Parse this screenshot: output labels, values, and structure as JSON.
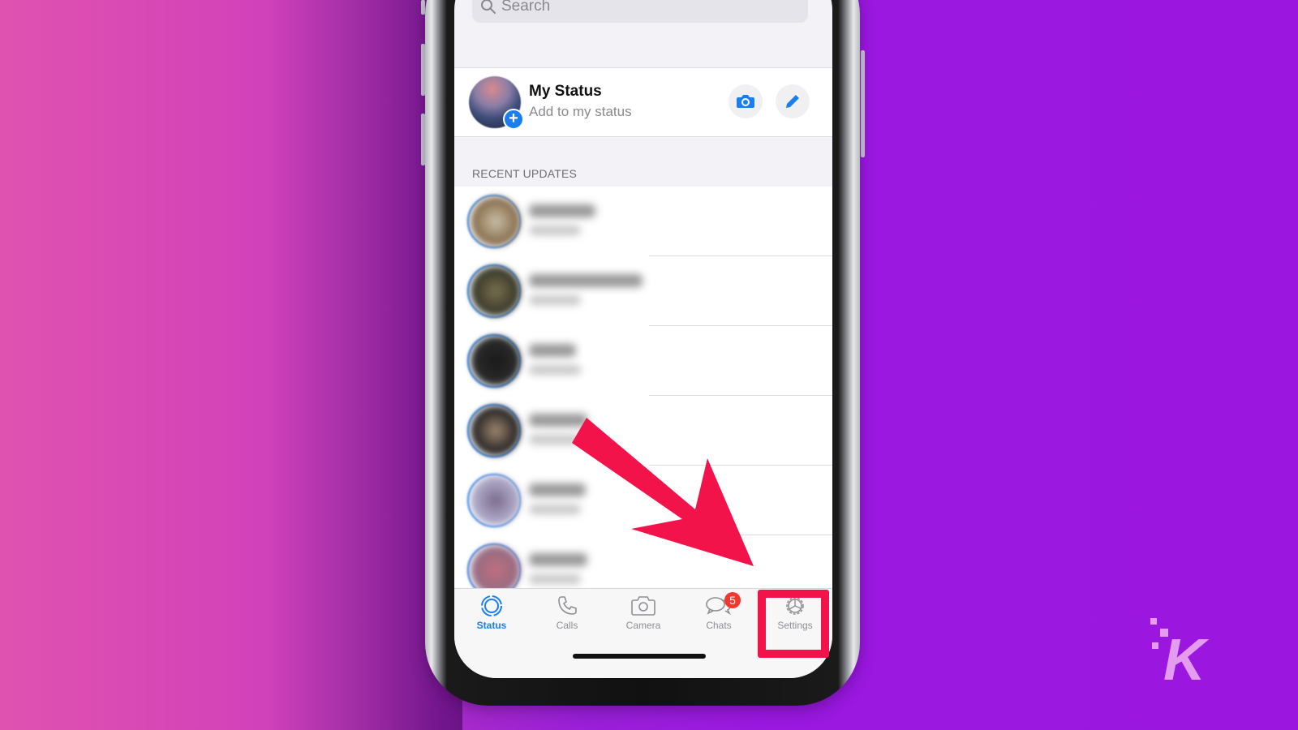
{
  "search": {
    "placeholder": "Search"
  },
  "my_status": {
    "title": "My Status",
    "subtitle": "Add to my status"
  },
  "section": {
    "recent_updates": "RECENT UPDATES"
  },
  "recent_updates": [
    {
      "name": "(blurred)",
      "time": "(blurred)"
    },
    {
      "name": "(blurred)",
      "time": "(blurred)"
    },
    {
      "name": "(blurred)",
      "time": "(blurred)"
    },
    {
      "name": "(blurred)",
      "time": "(blurred)"
    },
    {
      "name": "(blurred)",
      "time": "(blurred)"
    },
    {
      "name": "(blurred)",
      "time": "(blurred)"
    }
  ],
  "tabbar": {
    "tabs": [
      {
        "label": "Status",
        "icon": "status-icon",
        "active": true
      },
      {
        "label": "Calls",
        "icon": "phone-icon",
        "active": false
      },
      {
        "label": "Camera",
        "icon": "camera-icon",
        "active": false
      },
      {
        "label": "Chats",
        "icon": "chat-bubbles-icon",
        "active": false,
        "badge": "5"
      },
      {
        "label": "Settings",
        "icon": "gear-icon",
        "active": false
      }
    ]
  },
  "annotation": {
    "highlight_target": "Settings",
    "arrow_color": "#f2134a"
  },
  "colors": {
    "accent": "#1a7ef2",
    "badge": "#f2372f",
    "highlight": "#f2134a"
  },
  "brand": {
    "logo_letter": "K"
  }
}
